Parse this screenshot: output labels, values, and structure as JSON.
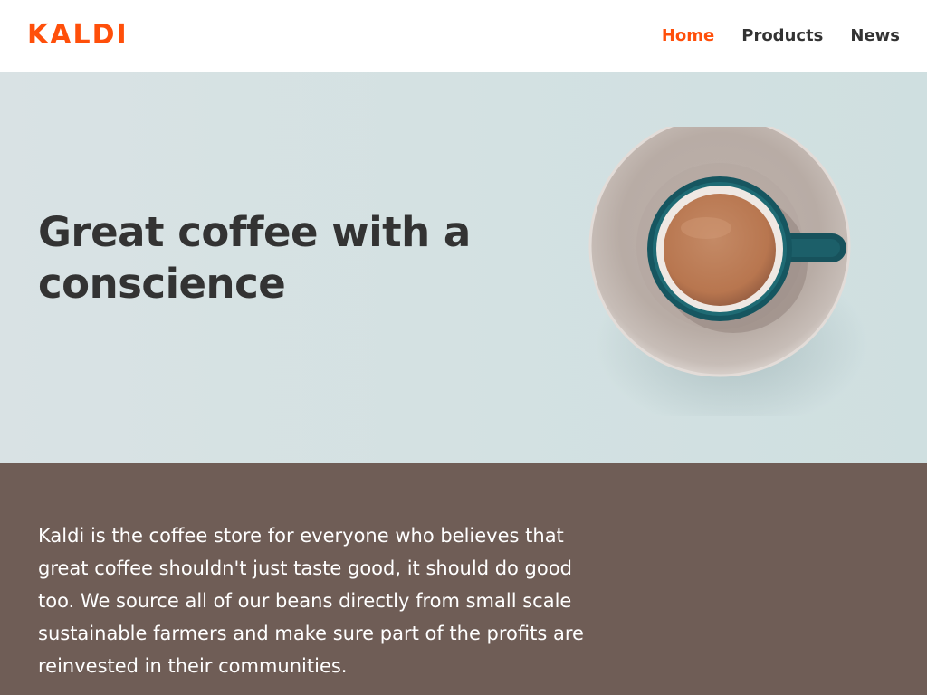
{
  "brand": {
    "logo_text": "KALDI",
    "accent_color": "#ff4f0a"
  },
  "nav": {
    "items": [
      {
        "label": "Home",
        "active": true
      },
      {
        "label": "Products",
        "active": false
      },
      {
        "label": "News",
        "active": false
      }
    ]
  },
  "hero": {
    "title": "Great coffee with a conscience",
    "image_icon": "coffee-cup-icon",
    "background_color": "#d5e1e2"
  },
  "about": {
    "text": "Kaldi is the coffee store for everyone who believes that great coffee shouldn't just taste good, it should do good too. We source all of our beans directly from small scale sustainable farmers and make sure part of the profits are reinvested in their communities.",
    "background_color": "#6f5d56"
  }
}
